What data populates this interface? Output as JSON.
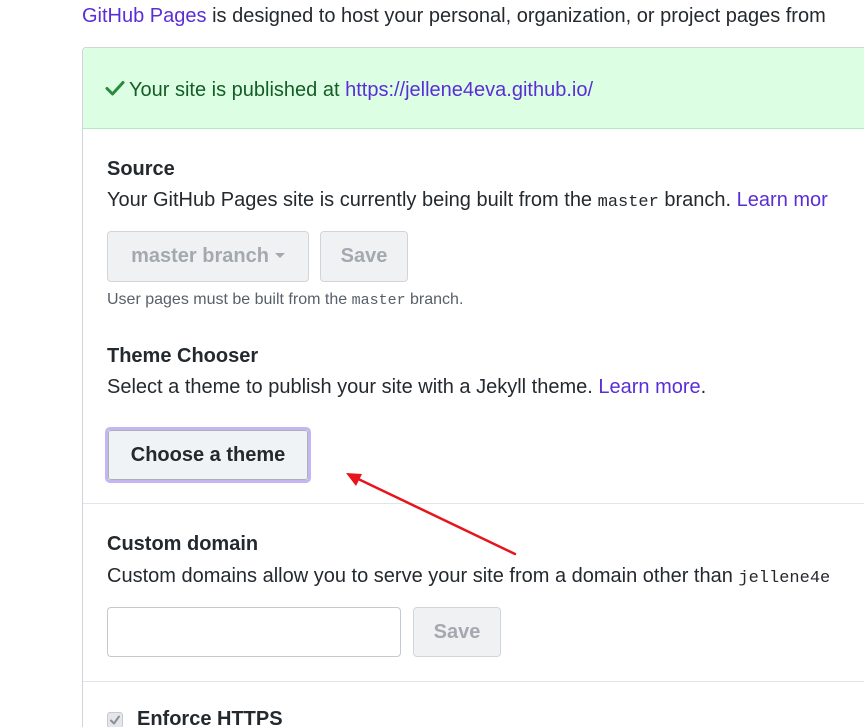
{
  "intro": {
    "link_text": "GitHub Pages",
    "rest_text": " is designed to host your personal, organization, or project pages from"
  },
  "flash": {
    "icon": "check-icon",
    "message": "Your site is published at ",
    "url": "https://jellene4eva.github.io/",
    "color": "#165c26",
    "background": "#dcffe4"
  },
  "source": {
    "title": "Source",
    "desc_before": "Your GitHub Pages site is currently being built from the ",
    "desc_code": "master",
    "desc_after": " branch. ",
    "learn_more": "Learn mor",
    "branch_select": "master branch",
    "save_label": "Save",
    "note_before": "User pages must be built from the ",
    "note_code": "master",
    "note_after": " branch."
  },
  "theme": {
    "title": "Theme Chooser",
    "desc": "Select a theme to publish your site with a Jekyll theme. ",
    "learn_more": "Learn more",
    "period": ".",
    "button_label": "Choose a theme"
  },
  "custom_domain": {
    "title": "Custom domain",
    "desc": "Custom domains allow you to serve your site from a domain other than ",
    "desc_code": "jellene4e",
    "input_value": "",
    "input_placeholder": "",
    "save_label": "Save"
  },
  "https": {
    "label": "Enforce HTTPS",
    "checked": true
  },
  "annotation": {
    "arrow_color": "#e8141c"
  },
  "colors": {
    "link": "#5a2ed6",
    "text": "#24292e",
    "focus_ring": "#c5b5f0"
  }
}
